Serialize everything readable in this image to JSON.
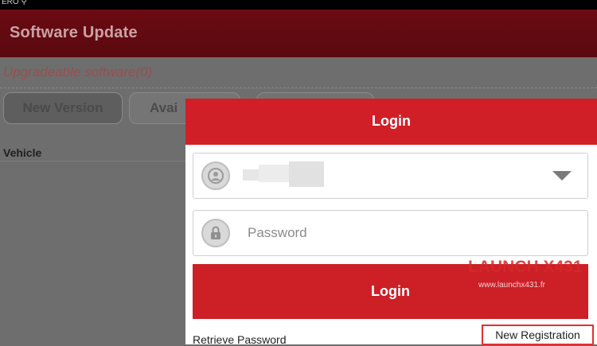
{
  "status_bar": {
    "text": "ERO ⚲"
  },
  "header": {
    "title": "Software Update"
  },
  "background": {
    "upgradeable_label": "Upgradeable software(0)",
    "tabs": [
      {
        "label": "New Version"
      },
      {
        "label": "Avai"
      },
      {
        "label": ""
      }
    ],
    "column_header": "Vehicle"
  },
  "login_dialog": {
    "title": "Login",
    "username": {
      "value": "",
      "icon": "user-icon"
    },
    "password": {
      "placeholder": "Password",
      "icon": "lock-icon"
    },
    "login_button": "Login",
    "retrieve_password": "Retrieve Password",
    "new_registration": "New Registration",
    "accent_color": "#d11f27"
  },
  "watermark": {
    "logo": "LAUNCH X431",
    "url": "www.launchx431.fr"
  }
}
